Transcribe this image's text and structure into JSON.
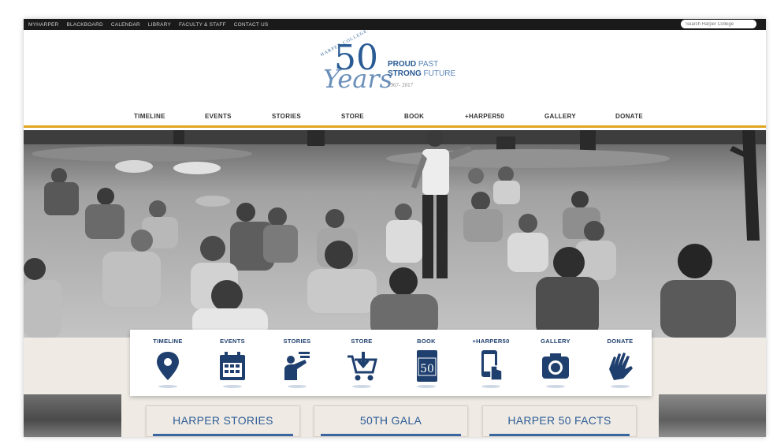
{
  "utility_nav": {
    "links": [
      "MYHARPER",
      "BLACKBOARD",
      "CALENDAR",
      "LIBRARY",
      "FACULTY & STAFF",
      "CONTACT US"
    ],
    "search_placeholder": "Search Harper College"
  },
  "logo": {
    "arc_text": "HARPER COLLEGE",
    "number": "50",
    "script_word": "Years",
    "tagline_1_bold": "PROUD",
    "tagline_1_light": " PAST",
    "tagline_2_bold": "STRONG",
    "tagline_2_light": " FUTURE",
    "years_range": "1967- 2017"
  },
  "main_nav": [
    "TIMELINE",
    "EVENTS",
    "STORIES",
    "STORE",
    "BOOK",
    "+HARPER50",
    "GALLERY",
    "DONATE"
  ],
  "icon_menu": [
    {
      "label": "TIMELINE",
      "icon": "map-pin-icon"
    },
    {
      "label": "EVENTS",
      "icon": "calendar-icon"
    },
    {
      "label": "STORIES",
      "icon": "storyteller-icon"
    },
    {
      "label": "STORE",
      "icon": "shopping-cart-icon"
    },
    {
      "label": "BOOK",
      "icon": "book-icon"
    },
    {
      "label": "+HARPER50",
      "icon": "phone-tap-icon"
    },
    {
      "label": "GALLERY",
      "icon": "camera-icon"
    },
    {
      "label": "DONATE",
      "icon": "hand-icon"
    }
  ],
  "features": [
    "HARPER STORIES",
    "50TH GALA",
    "HARPER 50 FACTS"
  ],
  "colors": {
    "brand_blue": "#2a5b94",
    "icon_navy": "#1f3f6e",
    "accent_gold": "#e0a51f",
    "band_beige": "#efebe4"
  }
}
